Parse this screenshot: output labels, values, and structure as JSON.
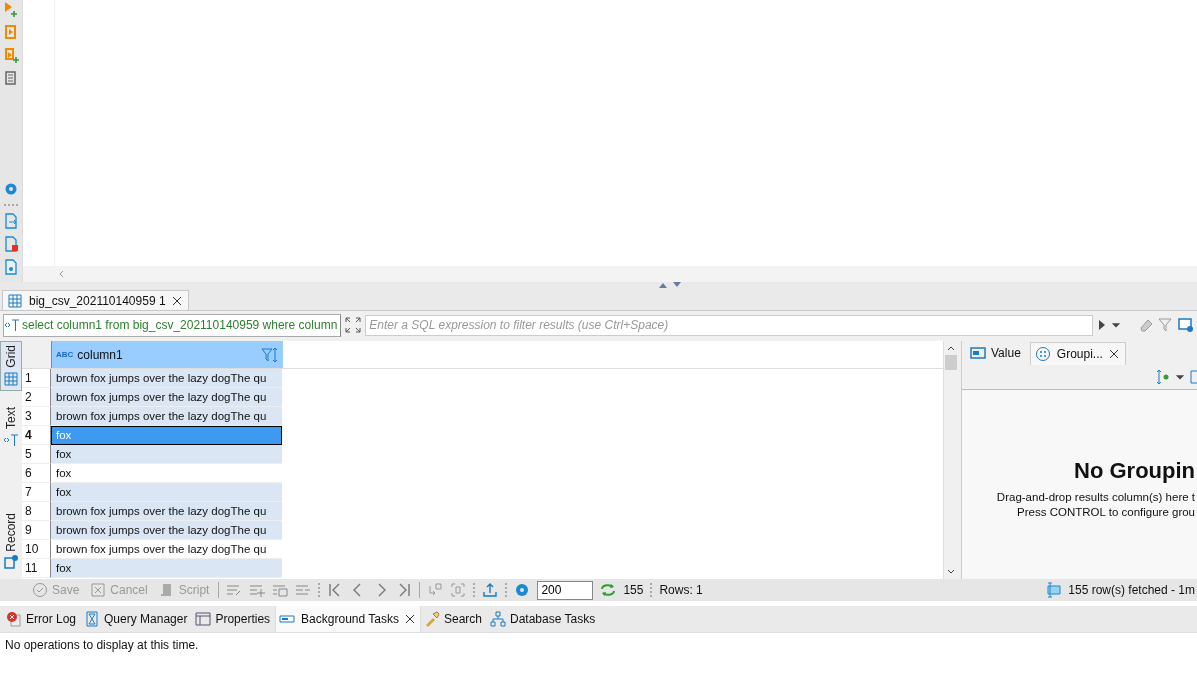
{
  "results_tab": {
    "label": "big_csv_202110140959 1",
    "selected": true
  },
  "query": {
    "text": "select column1 from big_csv_202110140959 where column"
  },
  "filter": {
    "placeholder": "Enter a SQL expression to filter results (use Ctrl+Space)"
  },
  "view_tabs": [
    {
      "label": "Grid",
      "selected": true
    },
    {
      "label": "Text",
      "selected": false
    },
    {
      "label": "Record",
      "selected": false
    }
  ],
  "grid": {
    "column": {
      "type_badge": "ABC",
      "label": "column1"
    },
    "rows": [
      {
        "number": "1",
        "value": "brown fox jumps over the lazy dogThe qu",
        "highlighted": true,
        "selected": false
      },
      {
        "number": "2",
        "value": "brown fox jumps over the lazy dogThe qu",
        "highlighted": true,
        "selected": false
      },
      {
        "number": "3",
        "value": "brown fox jumps over the lazy dogThe qu",
        "highlighted": true,
        "selected": false
      },
      {
        "number": "4",
        "value": "fox",
        "highlighted": true,
        "selected": true
      },
      {
        "number": "5",
        "value": "fox",
        "highlighted": true,
        "selected": false
      },
      {
        "number": "6",
        "value": "fox",
        "highlighted": false,
        "selected": false
      },
      {
        "number": "7",
        "value": "fox",
        "highlighted": true,
        "selected": false
      },
      {
        "number": "8",
        "value": "brown fox jumps over the lazy dogThe qu",
        "highlighted": true,
        "selected": false
      },
      {
        "number": "9",
        "value": "brown fox jumps over the lazy dogThe qu",
        "highlighted": true,
        "selected": false
      },
      {
        "number": "10",
        "value": "brown fox jumps over the lazy dogThe qu",
        "highlighted": false,
        "selected": false
      },
      {
        "number": "11",
        "value": "fox",
        "highlighted": true,
        "selected": false
      }
    ]
  },
  "panel_tabs": [
    {
      "label": "Value",
      "selected": false
    },
    {
      "label": "Groupi...",
      "selected": true
    }
  ],
  "grouping": {
    "title": "No Groupin",
    "lines": [
      "Drag-and-drop results column(s) here t",
      "Press CONTROL to configure grou"
    ]
  },
  "toolbar": {
    "buttons": [
      {
        "label": "Save",
        "disabled": true
      },
      {
        "label": "Cancel",
        "disabled": true
      },
      {
        "label": "Script",
        "disabled": true
      }
    ],
    "fetch_size": "200",
    "count": "155",
    "rows": "Rows: 1",
    "status": "155 row(s) fetched - 1m"
  },
  "bottom_tabs": [
    {
      "label": "Error Log",
      "selected": false
    },
    {
      "label": "Query Manager",
      "selected": false
    },
    {
      "label": "Properties",
      "selected": false
    },
    {
      "label": "Background Tasks",
      "selected": true
    },
    {
      "label": "Search",
      "selected": false
    },
    {
      "label": "Database Tasks",
      "selected": false
    }
  ],
  "message": "No operations to display at this time."
}
